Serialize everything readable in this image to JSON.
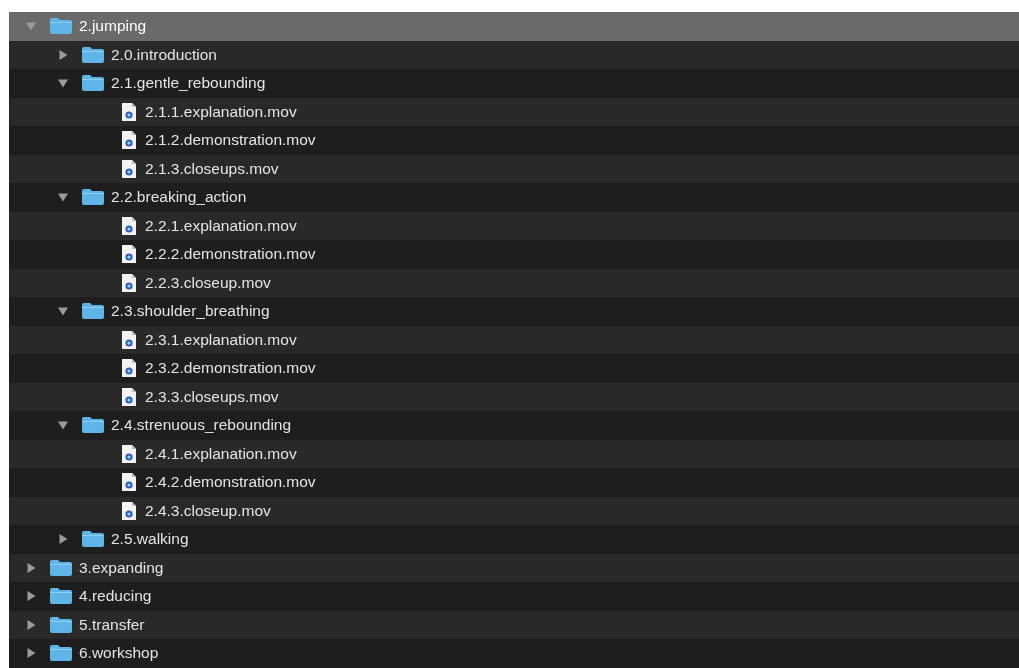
{
  "tree": [
    {
      "kind": "folder",
      "name": "2.jumping",
      "expanded": true,
      "selected": true,
      "children": [
        {
          "kind": "folder",
          "name": "2.0.introduction",
          "expanded": false,
          "selected": false
        },
        {
          "kind": "folder",
          "name": "2.1.gentle_rebounding",
          "expanded": true,
          "selected": false,
          "children": [
            {
              "kind": "file",
              "name": "2.1.1.explanation.mov",
              "selected": false
            },
            {
              "kind": "file",
              "name": "2.1.2.demonstration.mov",
              "selected": false
            },
            {
              "kind": "file",
              "name": "2.1.3.closeups.mov",
              "selected": false
            }
          ]
        },
        {
          "kind": "folder",
          "name": "2.2.breaking_action",
          "expanded": true,
          "selected": false,
          "children": [
            {
              "kind": "file",
              "name": "2.2.1.explanation.mov",
              "selected": false
            },
            {
              "kind": "file",
              "name": "2.2.2.demonstration.mov",
              "selected": false
            },
            {
              "kind": "file",
              "name": "2.2.3.closeup.mov",
              "selected": false
            }
          ]
        },
        {
          "kind": "folder",
          "name": "2.3.shoulder_breathing",
          "expanded": true,
          "selected": false,
          "children": [
            {
              "kind": "file",
              "name": "2.3.1.explanation.mov",
              "selected": false
            },
            {
              "kind": "file",
              "name": "2.3.2.demonstration.mov",
              "selected": false
            },
            {
              "kind": "file",
              "name": "2.3.3.closeups.mov",
              "selected": false
            }
          ]
        },
        {
          "kind": "folder",
          "name": "2.4.strenuous_rebounding",
          "expanded": true,
          "selected": false,
          "children": [
            {
              "kind": "file",
              "name": "2.4.1.explanation.mov",
              "selected": false
            },
            {
              "kind": "file",
              "name": "2.4.2.demonstration.mov",
              "selected": false
            },
            {
              "kind": "file",
              "name": "2.4.3.closeup.mov",
              "selected": false
            }
          ]
        },
        {
          "kind": "folder",
          "name": "2.5.walking",
          "expanded": false,
          "selected": false
        }
      ]
    },
    {
      "kind": "folder",
      "name": "3.expanding",
      "expanded": false,
      "selected": false
    },
    {
      "kind": "folder",
      "name": "4.reducing",
      "expanded": false,
      "selected": false
    },
    {
      "kind": "folder",
      "name": "5.transfer",
      "expanded": false,
      "selected": false
    },
    {
      "kind": "folder",
      "name": "6.workshop",
      "expanded": false,
      "selected": false
    }
  ]
}
